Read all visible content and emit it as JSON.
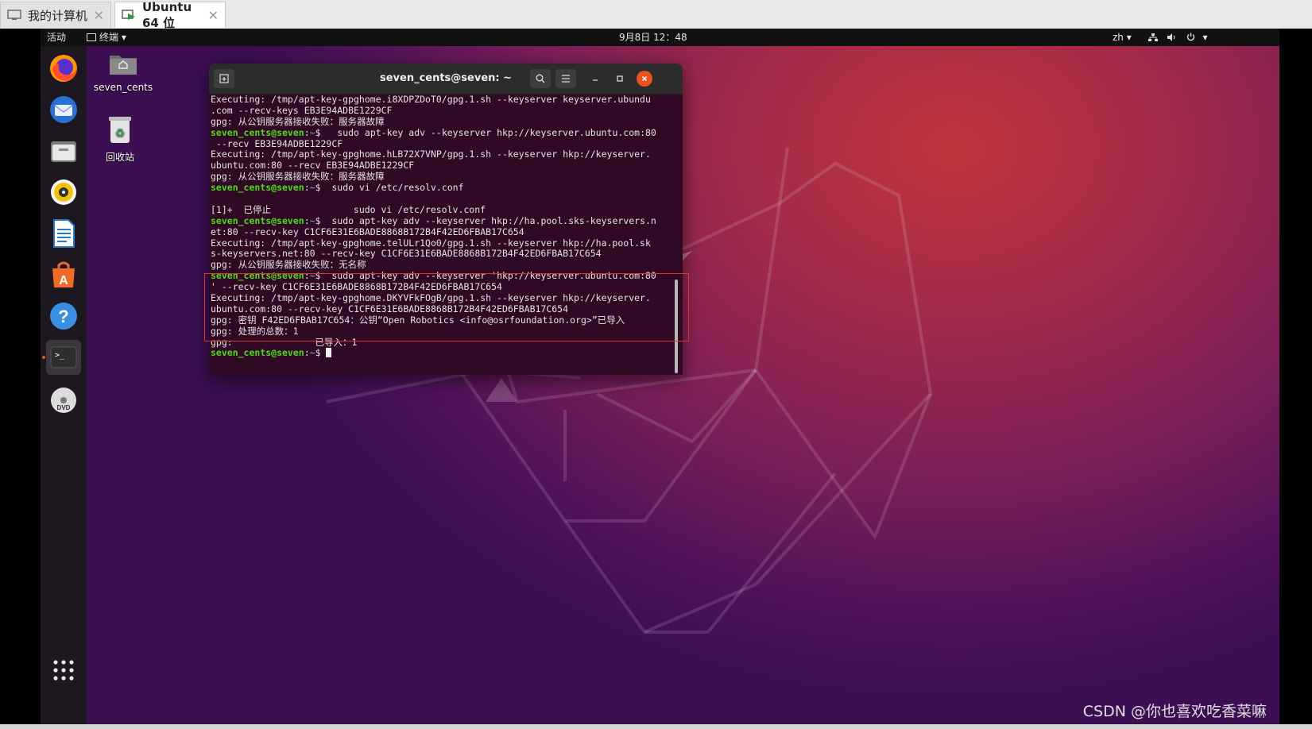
{
  "host": {
    "tabs": [
      {
        "label": "我的计算机",
        "icon": "monitor-icon",
        "close": "✕"
      },
      {
        "label": "Ubuntu 64 位",
        "icon": "vm-play-icon",
        "close": "✕"
      }
    ]
  },
  "topbar": {
    "activities": "活动",
    "app_menu": "终端",
    "clock": "9月8日 12：48",
    "lang": "zh",
    "colors": {
      "bg": "#111111",
      "text": "#e8e8e8"
    }
  },
  "dock": {
    "items": [
      {
        "name": "firefox-icon"
      },
      {
        "name": "thunderbird-icon"
      },
      {
        "name": "files-icon"
      },
      {
        "name": "rhythmbox-icon"
      },
      {
        "name": "libreoffice-writer-icon"
      },
      {
        "name": "ubuntu-software-icon"
      },
      {
        "name": "help-icon"
      },
      {
        "name": "terminal-icon"
      },
      {
        "name": "dvd-icon"
      },
      {
        "name": "show-applications-icon"
      }
    ]
  },
  "desktop": {
    "home_label": "seven_cents",
    "trash_label": "回收站"
  },
  "terminal": {
    "title": "seven_cents@seven: ~",
    "prompt_user": "seven_cents@seven",
    "prompt_sep": ":",
    "prompt_path": "~",
    "prompt_end": "$ ",
    "lines": [
      {
        "text": "Executing: /tmp/apt-key-gpghome.i8XDPZDoT0/gpg.1.sh --keyserver keyserver.ubundu"
      },
      {
        "text": ".com --recv-keys EB3E94ADBE1229CF"
      },
      {
        "text": "gpg: 从公钥服务器接收失败：服务器故障"
      },
      {
        "cmd": "  sudo apt-key adv --keyserver hkp://keyserver.ubuntu.com:80"
      },
      {
        "text": " --recv EB3E94ADBE1229CF"
      },
      {
        "text": "Executing: /tmp/apt-key-gpghome.hLB72X7VNP/gpg.1.sh --keyserver hkp://keyserver."
      },
      {
        "text": "ubuntu.com:80 --recv EB3E94ADBE1229CF"
      },
      {
        "text": "gpg: 从公钥服务器接收失败：服务器故障"
      },
      {
        "cmd": " sudo vi /etc/resolv.conf"
      },
      {
        "text": ""
      },
      {
        "text": "[1]+  已停止               sudo vi /etc/resolv.conf"
      },
      {
        "cmd": " sudo apt-key adv --keyserver hkp://ha.pool.sks-keyservers.n"
      },
      {
        "text": "et:80 --recv-key C1CF6E31E6BADE8868B172B4F42ED6FBAB17C654"
      },
      {
        "text": "Executing: /tmp/apt-key-gpghome.telULr1Qo0/gpg.1.sh --keyserver hkp://ha.pool.sk"
      },
      {
        "text": "s-keyservers.net:80 --recv-key C1CF6E31E6BADE8868B172B4F42ED6FBAB17C654"
      },
      {
        "text": "gpg: 从公钥服务器接收失败：无名称"
      },
      {
        "cmd": " sudo apt-key adv --keyserver 'hkp://keyserver.ubuntu.com:80"
      },
      {
        "text": "' --recv-key C1CF6E31E6BADE8868B172B4F42ED6FBAB17C654"
      },
      {
        "text": "Executing: /tmp/apt-key-gpghome.DKYVFkFOgB/gpg.1.sh --keyserver hkp://keyserver."
      },
      {
        "text": "ubuntu.com:80 --recv-key C1CF6E31E6BADE8868B172B4F42ED6FBAB17C654"
      },
      {
        "text": "gpg: 密钥 F42ED6FBAB17C654：公钥“Open Robotics <info@osrfoundation.org>”已导入"
      },
      {
        "text": "gpg: 处理的总数：1"
      },
      {
        "text": "gpg:               已导入：1"
      },
      {
        "cursor": true
      }
    ],
    "colors": {
      "bg": "#300a24",
      "prompt_user": "#4fdc1a",
      "prompt_path": "#5c8dd6",
      "text": "#e5e5e5"
    }
  },
  "watermark": "CSDN @你也喜欢吃香菜嘛"
}
